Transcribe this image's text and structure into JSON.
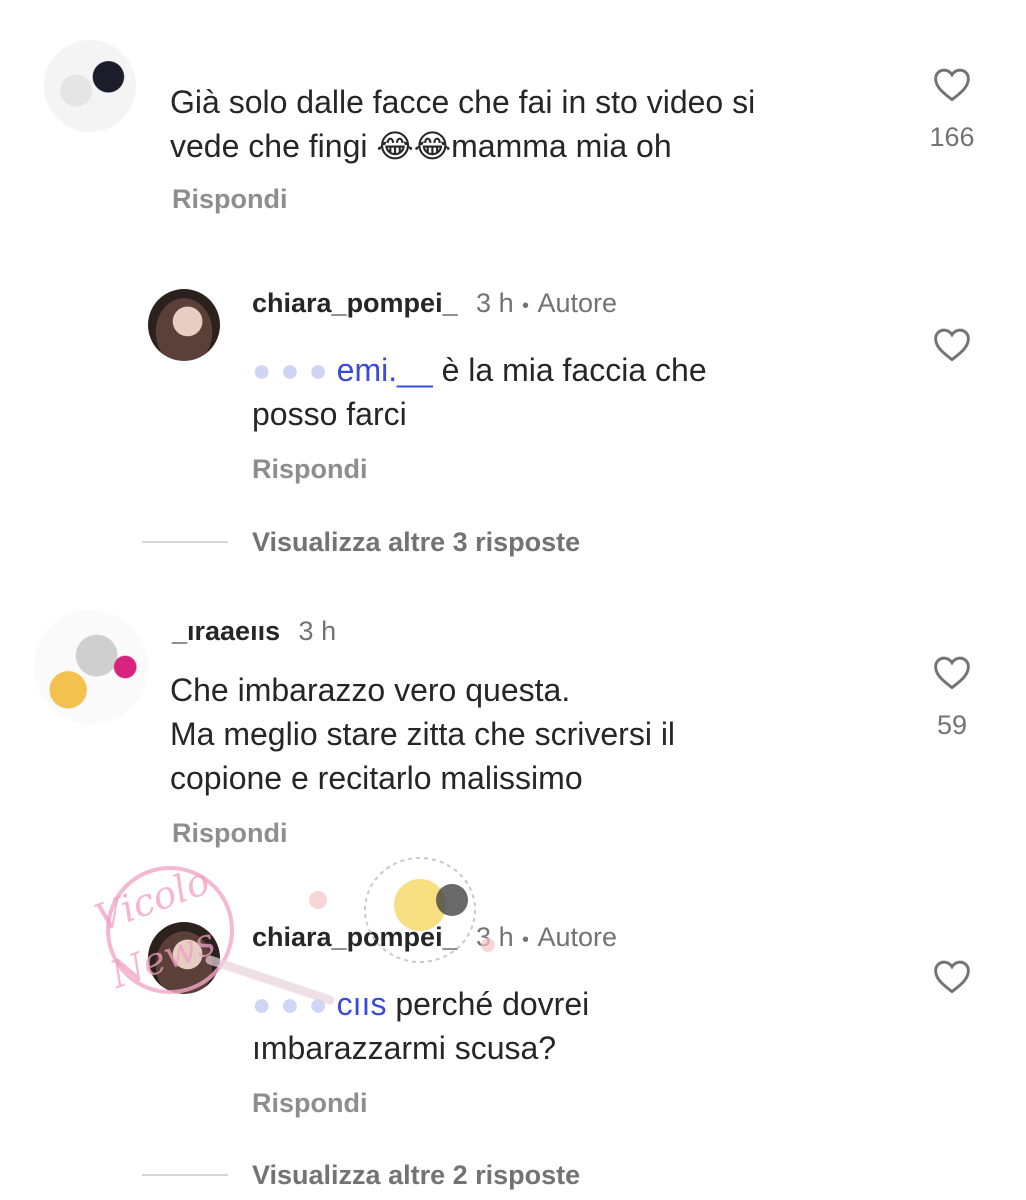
{
  "comments": [
    {
      "username": "",
      "time": "",
      "text_lines": [
        "Già solo dalle facce che fai in sto video si",
        "vede che fingi 😂😂mamma mia oh"
      ],
      "likes": "166",
      "reply_label": "Rispondi"
    },
    {
      "username": "chiara_pompei_",
      "time": "3 h",
      "dot": "•",
      "author_label": "Autore",
      "mention": "emi.__",
      "text_line1_rest": " è la mia faccia che",
      "text_line2": "posso farci",
      "reply_label": "Rispondi",
      "view_more": "Visualizza altre 3 risposte"
    },
    {
      "username": "_ıraaeııs",
      "time": "3 h",
      "text_lines": [
        "Che imbarazzo vero questa.",
        "Ma meglio stare zitta che scriversi il",
        "copione e recitarlo malissimo"
      ],
      "likes": "59",
      "reply_label": "Rispondi"
    },
    {
      "username": "chiara_pompei_",
      "time": "3 h",
      "dot": "•",
      "author_label": "Autore",
      "mention": "cııs",
      "text_line1_rest": " perché dovrei",
      "text_line2": "ımbarazzarmi scusa?",
      "reply_label": "Rispondi",
      "view_more": "Visualizza altre 2 risposte"
    }
  ],
  "watermark": {
    "text1": "Vicolo",
    "text2": "News"
  }
}
